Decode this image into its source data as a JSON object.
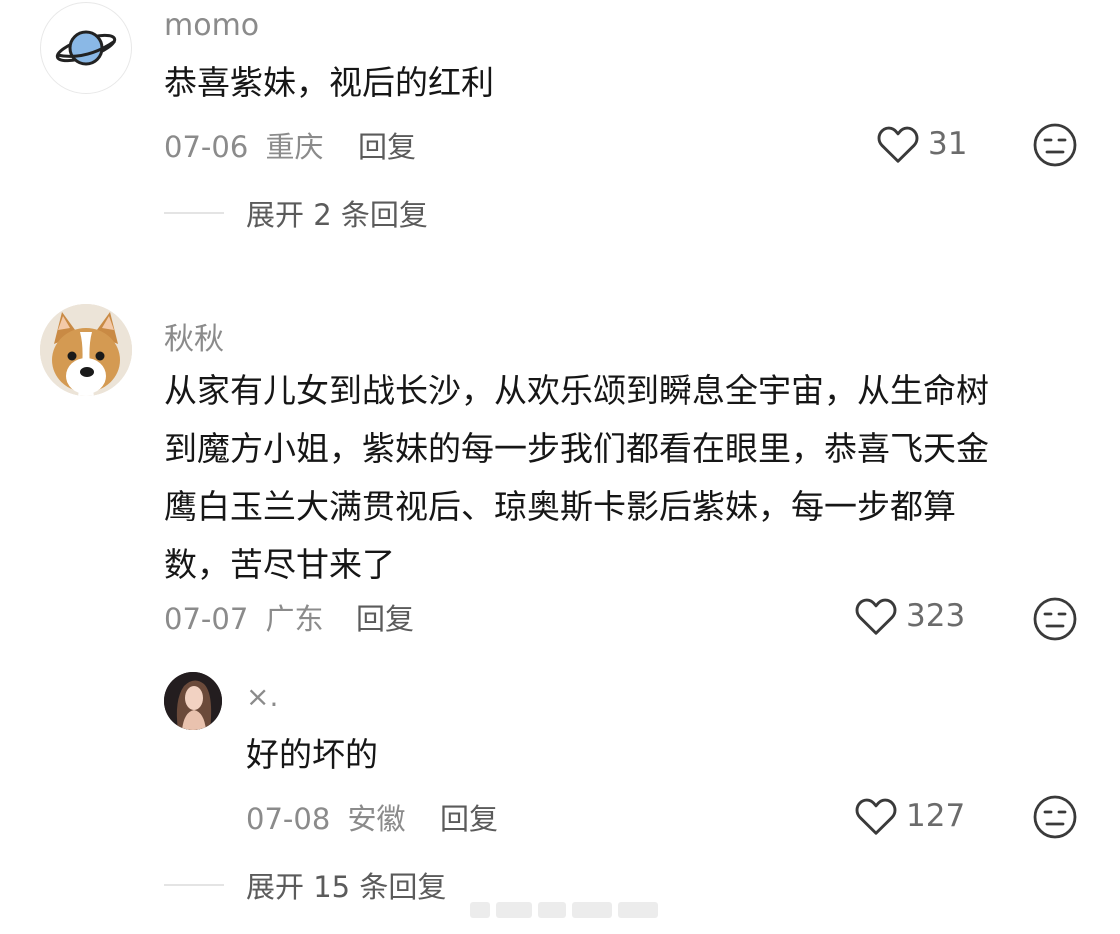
{
  "comments": [
    {
      "user": "momo",
      "text": "恭喜紫妹，视后的红利",
      "date": "07-06",
      "location": "重庆",
      "reply_label": "回复",
      "likes": "31",
      "expand": "展开 2 条回复",
      "avatar_icon": "planet-icon"
    },
    {
      "user": "秋秋",
      "text_lines": [
        "从家有儿女到战长沙，从欢乐颂到瞬息全宇宙，从生命树",
        "到魔方小姐，紫妹的每一步我们都看在眼里，恭喜飞天金",
        "鹰白玉兰大满贯视后、琼奥斯卡影后紫妹，每一步都算",
        "数，苦尽甘来了"
      ],
      "date": "07-07",
      "location": "广东",
      "reply_label": "回复",
      "likes": "323",
      "avatar_icon": "corgi-avatar",
      "replies": [
        {
          "user": "×.",
          "text": "好的坏的",
          "date": "07-08",
          "location": "安徽",
          "reply_label": "回复",
          "likes": "127"
        }
      ],
      "expand": "展开 15 条回复"
    }
  ],
  "icons": {
    "like": "heart-outline-icon",
    "dislike": "meh-face-icon"
  },
  "colors": {
    "username": "#8b8b8b",
    "text": "#161616",
    "meta": "#8b8b8b",
    "icon": "#3a3a3a"
  }
}
